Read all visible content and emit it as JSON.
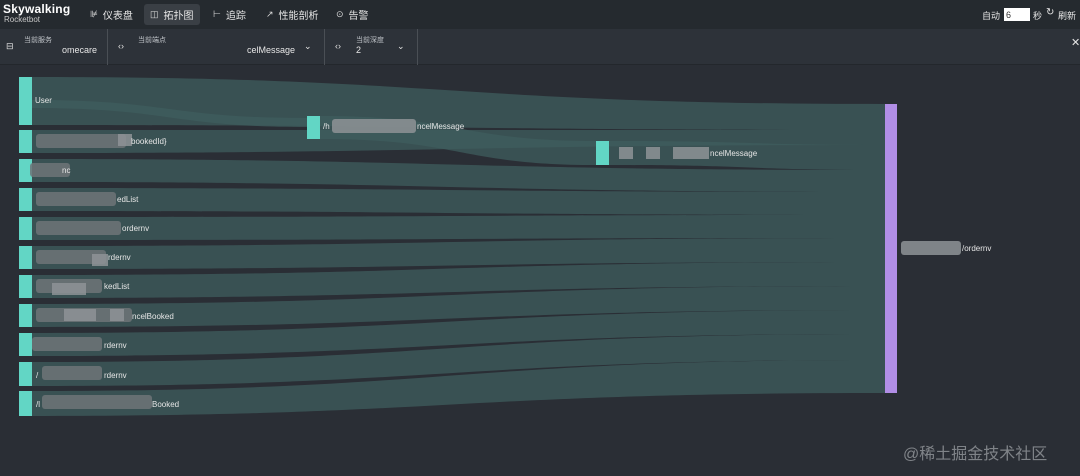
{
  "app": {
    "logo_line1": "Skywalking",
    "logo_line2": "Rocketbot"
  },
  "nav": [
    {
      "icon": "dashboard-icon",
      "glyph": "⊯",
      "label": "仪表盘"
    },
    {
      "icon": "topology-icon",
      "glyph": "◫",
      "label": "拓扑图",
      "active": true
    },
    {
      "icon": "trace-icon",
      "glyph": "⊢",
      "label": "追踪"
    },
    {
      "icon": "profile-icon",
      "glyph": "↗",
      "label": "性能剖析"
    },
    {
      "icon": "alarm-icon",
      "glyph": "⊙",
      "label": "告警"
    }
  ],
  "refresh": {
    "auto_label": "自动",
    "interval_value": "6",
    "seconds_label": "秒",
    "refresh_label": "刷新"
  },
  "selectors": {
    "service": {
      "title": "当前服务",
      "value": "omecare"
    },
    "endpoint": {
      "title": "当前端点",
      "value": "celMessage"
    },
    "depth": {
      "title": "当前深度",
      "value": "2"
    }
  },
  "sankey": {
    "sources": [
      {
        "label": "User"
      },
      {
        "label": "bookedId}"
      },
      {
        "label": "nc"
      },
      {
        "label": "edList"
      },
      {
        "label": "ordernv"
      },
      {
        "label": "rdernv"
      },
      {
        "label": "kedList"
      },
      {
        "label": "ncelBooked"
      },
      {
        "label": "rdernv"
      },
      {
        "label": "rdernv"
      },
      {
        "label": "Booked"
      }
    ],
    "source_prefixes": {
      "row9": "/",
      "row10": "/l"
    },
    "mid_nodes": [
      {
        "label": "/h",
        "suffix": "ncelMessage"
      },
      {
        "label": "ncelMessage"
      }
    ],
    "sink": {
      "label": "/ordernv"
    }
  },
  "watermark": "@稀土掘金技术社区"
}
